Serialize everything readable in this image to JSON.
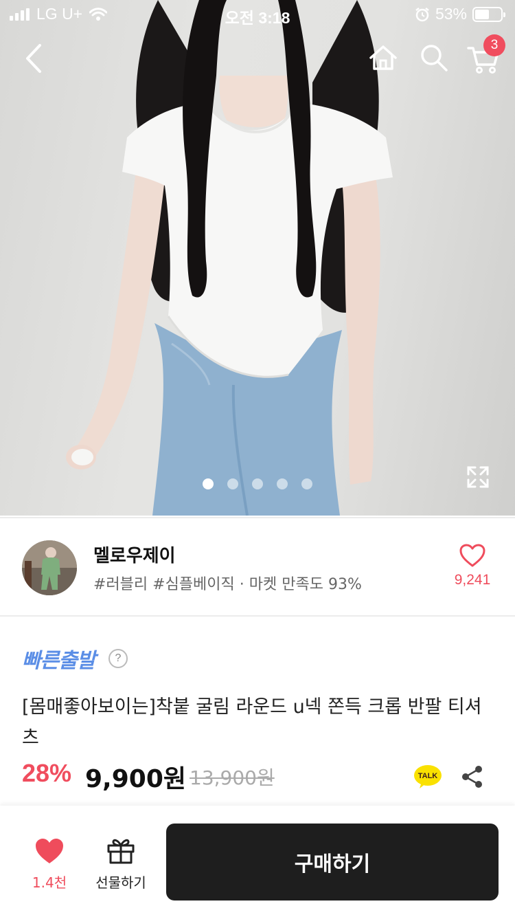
{
  "status_bar": {
    "carrier": "LG U+",
    "time": "오전 3:18",
    "battery_percent": "53%",
    "battery_level": 0.53
  },
  "nav": {
    "icons": [
      "back-icon",
      "home-icon",
      "search-icon",
      "cart-icon"
    ],
    "cart_count": "3"
  },
  "gallery": {
    "total_images": 5,
    "current_index": 0
  },
  "shop": {
    "name": "멜로우제이",
    "tags": "#러블리 #심플베이직 · 마켓 만족도 93%",
    "like_count": "9,241"
  },
  "product": {
    "fast_shipping": "빠른출발",
    "help": "?",
    "title": "[몸매좋아보이는]착붙 굴림 라운드 u넥 쫀득 크롭 반팔 티셔츠",
    "discount": "28%",
    "price": "9,900원",
    "original_price": "13,900원",
    "talk_label": "TALK"
  },
  "bottom_bar": {
    "like_label": "1.4천",
    "gift_label": "선물하기",
    "buy_label": "구매하기"
  },
  "colors": {
    "accent_red": "#f04d5e",
    "fast_blue": "#5b8ee6",
    "buy_button": "#1e1e1e",
    "talk_yellow": "#fae100"
  }
}
